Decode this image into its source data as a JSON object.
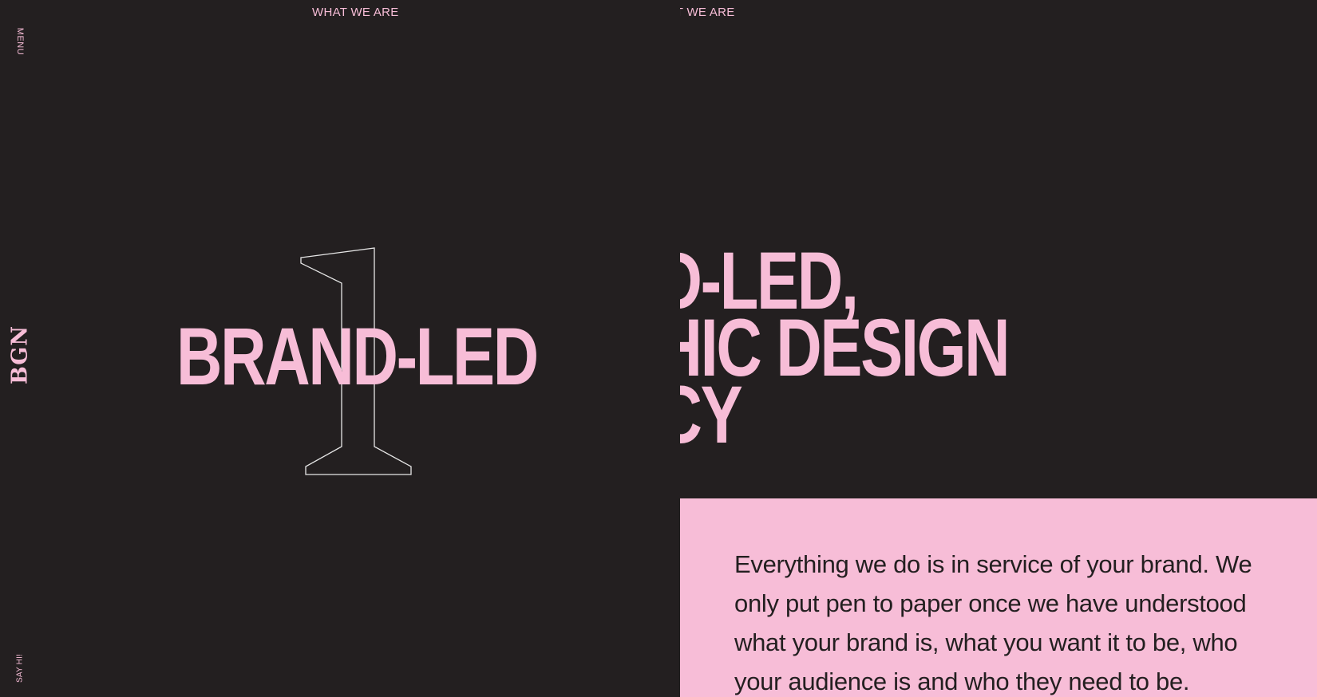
{
  "nav": {
    "menu_label": "MENU",
    "logo_text": "BGN",
    "sayhi_label": "SAY HI!"
  },
  "section": {
    "label_left": "WHAT WE ARE",
    "label_right": "WHAT WE ARE"
  },
  "hero": {
    "numeral": "1",
    "headline_left": "BRAND-LED",
    "headline_right": {
      "line1": "BRAND-LED,",
      "line2": "GRAPHIC DESIGN",
      "line3": "AGENCY"
    }
  },
  "info": {
    "text": "Everything we do is in service of your brand. We only put pen to paper once we have understood what your brand is, what you want it to be, who your audience is and who they need to be."
  },
  "colors": {
    "background": "#231f20",
    "accent_pink": "#f7bdd7",
    "numeral_outline": "#e6e6e6"
  }
}
